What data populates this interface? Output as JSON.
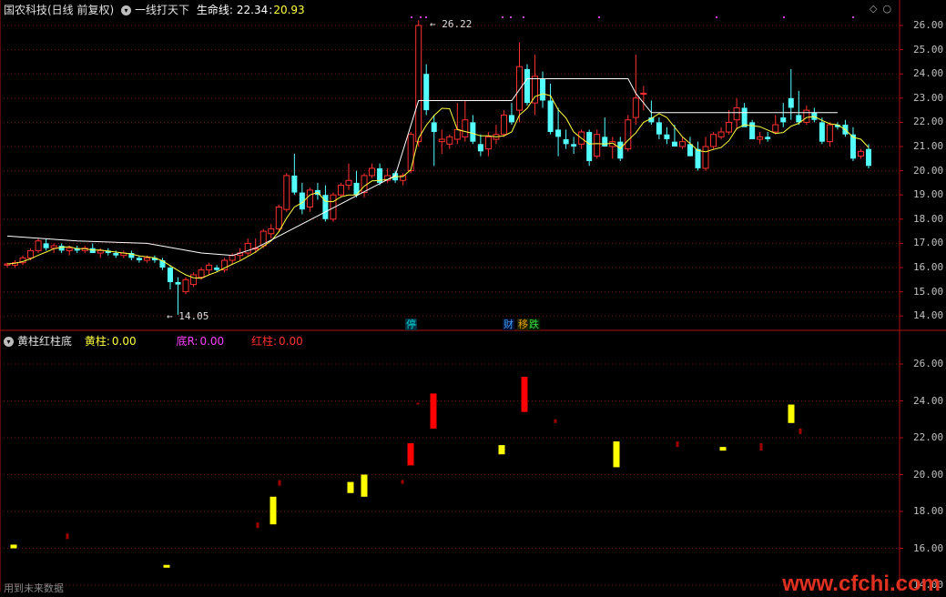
{
  "top": {
    "stock_name": "国农科技(日线 前复权)",
    "indicator_name": "一线打天下",
    "lifeline_label": "生命线:",
    "lifeline_value1": "22.34",
    "lifeline_value2": "20.93",
    "high_annotation": "26.22",
    "low_annotation": "14.05",
    "y_ticks": [
      "26.00",
      "25.00",
      "24.00",
      "23.00",
      "22.00",
      "21.00",
      "20.00",
      "19.00",
      "18.00",
      "17.00",
      "16.00",
      "15.00",
      "14.00"
    ],
    "tags": [
      {
        "text": "停",
        "color": "#00d8d8",
        "bg": "#003040"
      },
      {
        "text": "财",
        "color": "#40a0ff",
        "bg": "#001030"
      },
      {
        "text": "移",
        "color": "#e0a000",
        "bg": "#202000"
      },
      {
        "text": "跌",
        "color": "#40e040",
        "bg": "#002000"
      }
    ],
    "icons": [
      "diamond-icon",
      "circle-icon"
    ]
  },
  "bottom": {
    "indicator_name": "黄柱红柱底",
    "yellow_label": "黄柱:",
    "yellow_value": "0.00",
    "bottom_label": "底R:",
    "bottom_value": "0.00",
    "red_label": "红柱:",
    "red_value": "0.00",
    "y_ticks": [
      "26.00",
      "24.00",
      "22.00",
      "20.00",
      "18.00",
      "16.00",
      "14.00"
    ]
  },
  "footer_note": "用到未来数据",
  "watermark": "www.cfchi.com",
  "colors": {
    "up": "#ff3030",
    "down": "#54ffff",
    "ma": "#ffff40",
    "line": "#ffffff",
    "grid": "#7a1010",
    "yellow": "#ffff00",
    "red": "#ff0000"
  }
}
